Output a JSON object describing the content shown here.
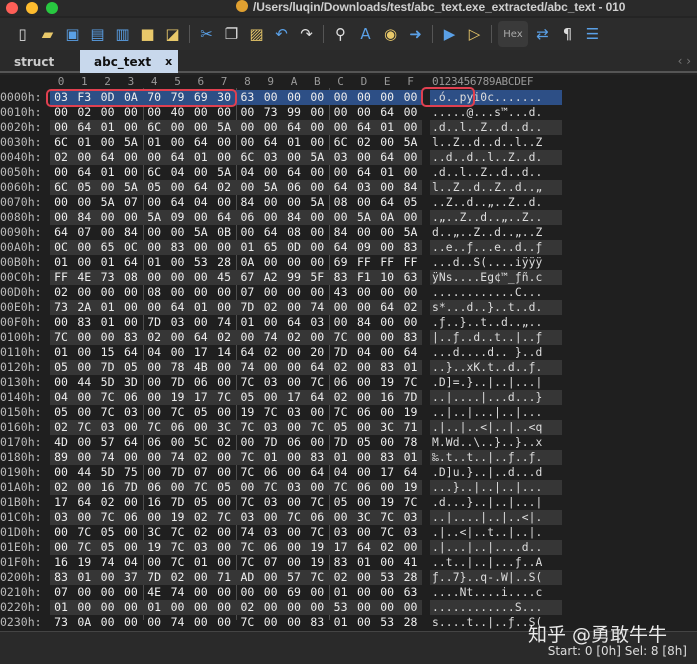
{
  "window": {
    "title": "/Users/luqin/Downloads/test/abc_text.exe_extracted/abc_text - 010"
  },
  "toolbar": {
    "hex_label": "Hex"
  },
  "tabs": [
    {
      "label": "struct"
    },
    {
      "label": "abc_text",
      "close": "x"
    }
  ],
  "header": {
    "columns": [
      "0",
      "1",
      "2",
      "3",
      "4",
      "5",
      "6",
      "7",
      "8",
      "9",
      "A",
      "B",
      "C",
      "D",
      "E",
      "F"
    ],
    "ascii": "0123456789ABCDEF"
  },
  "rows": [
    {
      "offset": "0000h:",
      "bytes": "03 F3 0D 0A 70 79 69 30 63 00 00 00 00 00 00 00",
      "ascii": ".ó..pyi0c......."
    },
    {
      "offset": "0010h:",
      "bytes": "00 02 00 00 00 40 00 00 00 73 99 00 00 00 64 00",
      "ascii": ".....@...s™...d."
    },
    {
      "offset": "0020h:",
      "bytes": "00 64 01 00 6C 00 00 5A 00 00 64 00 00 64 01 00",
      "ascii": ".d..l..Z..d..d.."
    },
    {
      "offset": "0030h:",
      "bytes": "6C 01 00 5A 01 00 64 00 00 64 01 00 6C 02 00 5A",
      "ascii": "l..Z..d..d..l..Z"
    },
    {
      "offset": "0040h:",
      "bytes": "02 00 64 00 00 64 01 00 6C 03 00 5A 03 00 64 00",
      "ascii": "..d..d..l..Z..d."
    },
    {
      "offset": "0050h:",
      "bytes": "00 64 01 00 6C 04 00 5A 04 00 64 00 00 64 01 00",
      "ascii": ".d..l..Z..d..d.."
    },
    {
      "offset": "0060h:",
      "bytes": "6C 05 00 5A 05 00 64 02 00 5A 06 00 64 03 00 84",
      "ascii": "l..Z..d..Z..d..„"
    },
    {
      "offset": "0070h:",
      "bytes": "00 00 5A 07 00 64 04 00 84 00 00 5A 08 00 64 05",
      "ascii": "..Z..d..„..Z..d."
    },
    {
      "offset": "0080h:",
      "bytes": "00 84 00 00 5A 09 00 64 06 00 84 00 00 5A 0A 00",
      "ascii": ".„..Z..d..„..Z.."
    },
    {
      "offset": "0090h:",
      "bytes": "64 07 00 84 00 00 5A 0B 00 64 08 00 84 00 00 5A",
      "ascii": "d..„..Z..d..„..Z"
    },
    {
      "offset": "00A0h:",
      "bytes": "0C 00 65 0C 00 83 00 00 01 65 0D 00 64 09 00 83",
      "ascii": "..e..ƒ...e..d..ƒ"
    },
    {
      "offset": "00B0h:",
      "bytes": "01 00 01 64 01 00 53 28 0A 00 00 00 69 FF FF FF",
      "ascii": "...d..S(....iÿÿÿ"
    },
    {
      "offset": "00C0h:",
      "bytes": "FF 4E 73 08 00 00 00 45 67 A2 99 5F 83 F1 10 63",
      "ascii": "ÿNs....Eg¢™_ƒñ.c"
    },
    {
      "offset": "00D0h:",
      "bytes": "02 00 00 00 08 00 00 00 07 00 00 00 43 00 00 00",
      "ascii": "............C..."
    },
    {
      "offset": "00E0h:",
      "bytes": "73 2A 01 00 00 64 01 00 7D 02 00 74 00 00 64 02",
      "ascii": "s*...d..}..t..d."
    },
    {
      "offset": "00F0h:",
      "bytes": "00 83 01 00 7D 03 00 74 01 00 64 03 00 84 00 00",
      "ascii": ".ƒ..}..t..d..„.."
    },
    {
      "offset": "0100h:",
      "bytes": "7C 00 00 83 02 00 64 02 00 74 02 00 7C 00 00 83",
      "ascii": "|..ƒ..d..t..|..ƒ"
    },
    {
      "offset": "0110h:",
      "bytes": "01 00 15 64 04 00 17 14 64 02 00 20 7D 04 00 64",
      "ascii": "...d....d.. }..d"
    },
    {
      "offset": "0120h:",
      "bytes": "05 00 7D 05 00 78 4B 00 74 00 00 64 02 00 83 01",
      "ascii": "..}..xK.t..d..ƒ."
    },
    {
      "offset": "0130h:",
      "bytes": "00 44 5D 3D 00 7D 06 00 7C 03 00 7C 06 00 19 7C",
      "ascii": ".D]=.}..|..|...|"
    },
    {
      "offset": "0140h:",
      "bytes": "04 00 7C 06 00 19 17 7C 05 00 17 64 02 00 16 7D",
      "ascii": "..|....|...d...}"
    },
    {
      "offset": "0150h:",
      "bytes": "05 00 7C 03 00 7C 05 00 19 7C 03 00 7C 06 00 19",
      "ascii": "..|..|...|..|..."
    },
    {
      "offset": "0160h:",
      "bytes": "02 7C 03 00 7C 06 00 3C 7C 03 00 7C 05 00 3C 71",
      "ascii": ".|..|..<|..|..<q"
    },
    {
      "offset": "0170h:",
      "bytes": "4D 00 57 64 06 00 5C 02 00 7D 06 00 7D 05 00 78",
      "ascii": "M.Wd..\\..}..}..x"
    },
    {
      "offset": "0180h:",
      "bytes": "89 00 74 00 00 74 02 00 7C 01 00 83 01 00 83 01",
      "ascii": "‰.t..t..|..ƒ..ƒ."
    },
    {
      "offset": "0190h:",
      "bytes": "00 44 5D 75 00 7D 07 00 7C 06 00 64 04 00 17 64",
      "ascii": ".D]u.}..|..d...d"
    },
    {
      "offset": "01A0h:",
      "bytes": "02 00 16 7D 06 00 7C 05 00 7C 03 00 7C 06 00 19",
      "ascii": "...}..|..|..|..."
    },
    {
      "offset": "01B0h:",
      "bytes": "17 64 02 00 16 7D 05 00 7C 03 00 7C 05 00 19 7C",
      "ascii": ".d...}..|..|...|"
    },
    {
      "offset": "01C0h:",
      "bytes": "03 00 7C 06 00 19 02 7C 03 00 7C 06 00 3C 7C 03",
      "ascii": "..|....|..|..<|."
    },
    {
      "offset": "01D0h:",
      "bytes": "00 7C 05 00 3C 7C 02 00 74 03 00 7C 03 00 7C 03",
      "ascii": ".|..<|..t..|..|."
    },
    {
      "offset": "01E0h:",
      "bytes": "00 7C 05 00 19 7C 03 00 7C 06 00 19 17 64 02 00",
      "ascii": ".|...|..|....d.."
    },
    {
      "offset": "01F0h:",
      "bytes": "16 19 74 04 00 7C 01 00 7C 07 00 19 83 01 00 41",
      "ascii": "..t..|..|...ƒ..A"
    },
    {
      "offset": "0200h:",
      "bytes": "83 01 00 37 7D 02 00 71 AD 00 57 7C 02 00 53 28",
      "ascii": "ƒ..7}..q-.W|..S("
    },
    {
      "offset": "0210h:",
      "bytes": "07 00 00 00 4E 74 00 00 00 00 69 00 01 00 00 63",
      "ascii": "....Nt....i....c"
    },
    {
      "offset": "0220h:",
      "bytes": "01 00 00 00 01 00 00 00 02 00 00 00 53 00 00 00",
      "ascii": "............S..."
    },
    {
      "offset": "0230h:",
      "bytes": "73 0A 00 00 00 74 00 00 7C 00 00 83 01 00 53 28",
      "ascii": "s....t..|..ƒ..S("
    }
  ],
  "status": {
    "text": "Start: 0 [0h]  Sel: 8 [8h]"
  },
  "watermark": "知乎 @勇敢牛牛",
  "colors": {
    "selection": "#2d4f86",
    "highlight_box": "#e04050",
    "tab_active": "#c8d8ec"
  }
}
